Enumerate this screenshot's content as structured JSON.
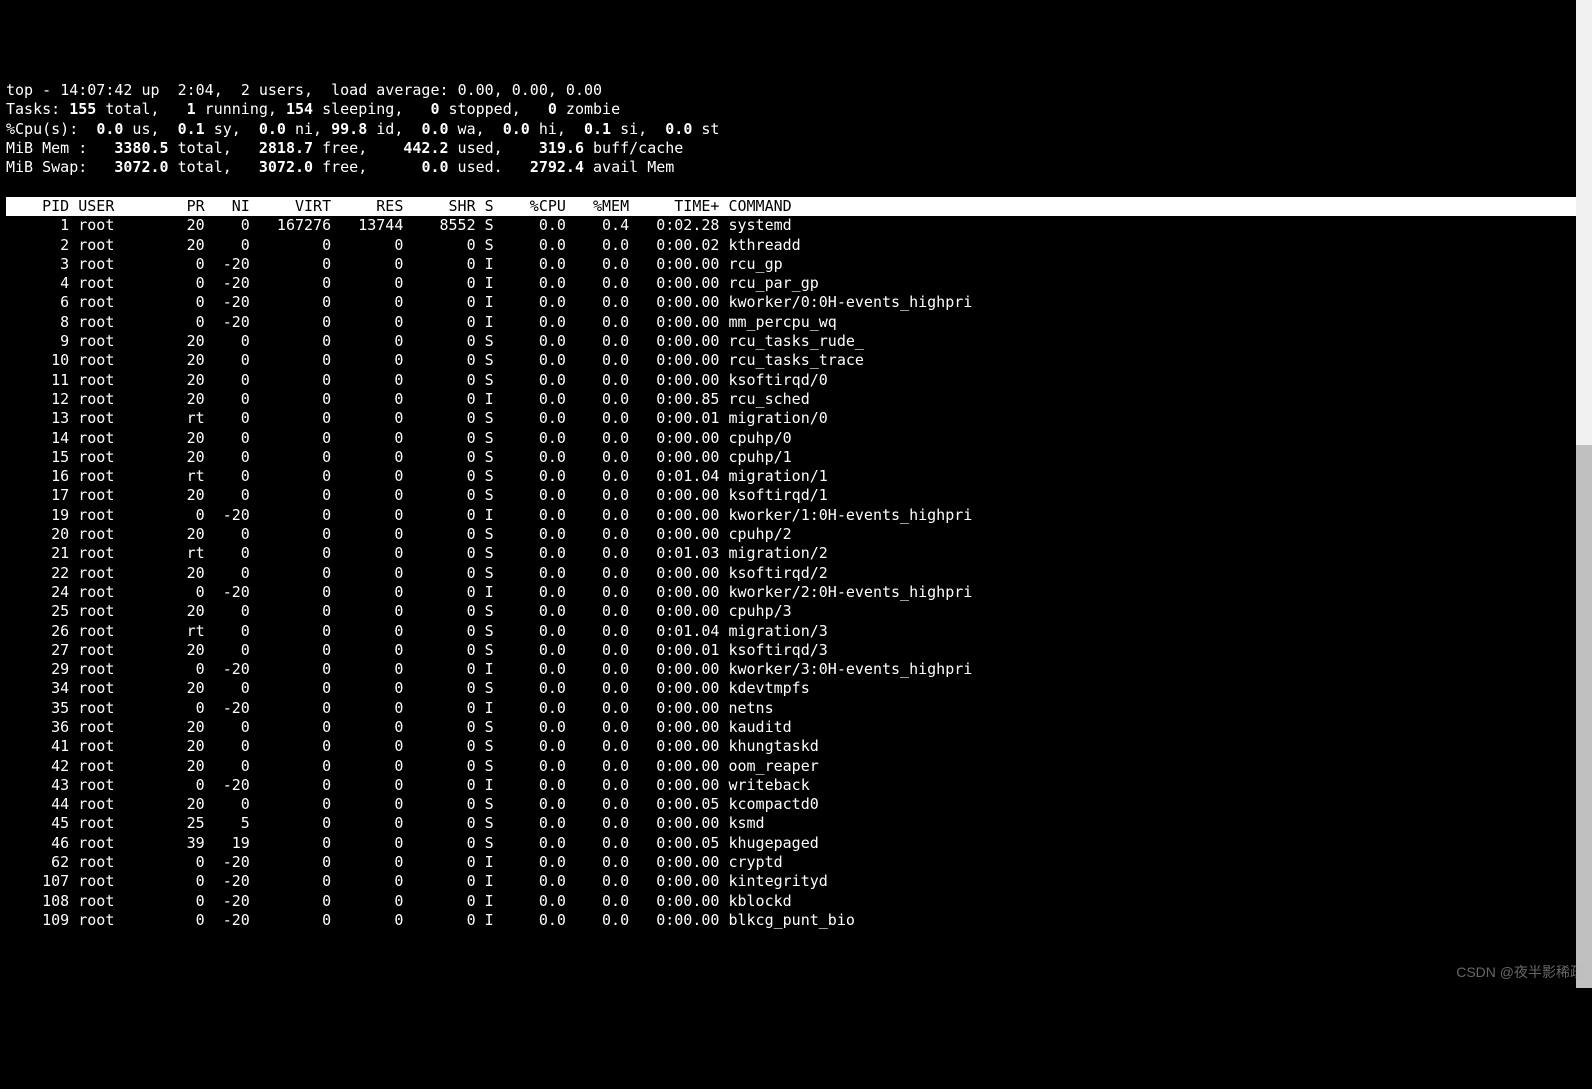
{
  "scrollbar": {
    "thumb_top_pct": 45,
    "thumb_height_pct": 55
  },
  "watermark": "CSDN @夜半影稀疏",
  "summary": {
    "line1": {
      "prefix": "top - ",
      "time": "14:07:42",
      "up_word": " up ",
      "uptime": " 2:04",
      "sep0": ",  ",
      "users": "2",
      "users_word": " users,  ",
      "la_word": "load average: ",
      "la": "0.00, 0.00, 0.00"
    },
    "line2": {
      "tasks_word": "Tasks: ",
      "total": "155",
      "total_word": " total,   ",
      "running": "1",
      "running_word": " running, ",
      "sleeping": "154",
      "sleeping_word": " sleeping,   ",
      "stopped": "0",
      "stopped_word": " stopped,   ",
      "zombie": "0",
      "zombie_word": " zombie"
    },
    "line3": {
      "cpu_word": "%Cpu(s):  ",
      "us": "0.0",
      "us_word": " us,  ",
      "sy": "0.1",
      "sy_word": " sy,  ",
      "ni": "0.0",
      "ni_word": " ni, ",
      "id": "99.8",
      "id_word": " id,  ",
      "wa": "0.0",
      "wa_word": " wa,  ",
      "hi": "0.0",
      "hi_word": " hi,  ",
      "si": "0.1",
      "si_word": " si,  ",
      "st": "0.0",
      "st_word": " st"
    },
    "line4": {
      "mem_word": "MiB Mem :   ",
      "total": "3380.5",
      "total_word": " total,   ",
      "free": "2818.7",
      "free_word": " free,    ",
      "used": "442.2",
      "used_word": " used,    ",
      "buff": "319.6",
      "buff_word": " buff/cache"
    },
    "line5": {
      "swap_word": "MiB Swap:   ",
      "total": "3072.0",
      "total_word": " total,   ",
      "free": "3072.0",
      "free_word": " free,      ",
      "used": "0.0",
      "used_word": " used.   ",
      "avail": "2792.4",
      "avail_word": " avail Mem"
    }
  },
  "columns": [
    "PID",
    "USER",
    "PR",
    "NI",
    "VIRT",
    "RES",
    "SHR",
    "S",
    "%CPU",
    "%MEM",
    "TIME+",
    "COMMAND"
  ],
  "widths": [
    7,
    9,
    4,
    4,
    8,
    7,
    7,
    2,
    6,
    6,
    9,
    30
  ],
  "aligns": [
    "r",
    "l",
    "r",
    "r",
    "r",
    "r",
    "r",
    "l",
    "r",
    "r",
    "r",
    "l"
  ],
  "processes": [
    [
      "1",
      "root",
      "20",
      "0",
      "167276",
      "13744",
      "8552",
      "S",
      "0.0",
      "0.4",
      "0:02.28",
      "systemd"
    ],
    [
      "2",
      "root",
      "20",
      "0",
      "0",
      "0",
      "0",
      "S",
      "0.0",
      "0.0",
      "0:00.02",
      "kthreadd"
    ],
    [
      "3",
      "root",
      "0",
      "-20",
      "0",
      "0",
      "0",
      "I",
      "0.0",
      "0.0",
      "0:00.00",
      "rcu_gp"
    ],
    [
      "4",
      "root",
      "0",
      "-20",
      "0",
      "0",
      "0",
      "I",
      "0.0",
      "0.0",
      "0:00.00",
      "rcu_par_gp"
    ],
    [
      "6",
      "root",
      "0",
      "-20",
      "0",
      "0",
      "0",
      "I",
      "0.0",
      "0.0",
      "0:00.00",
      "kworker/0:0H-events_highpri"
    ],
    [
      "8",
      "root",
      "0",
      "-20",
      "0",
      "0",
      "0",
      "I",
      "0.0",
      "0.0",
      "0:00.00",
      "mm_percpu_wq"
    ],
    [
      "9",
      "root",
      "20",
      "0",
      "0",
      "0",
      "0",
      "S",
      "0.0",
      "0.0",
      "0:00.00",
      "rcu_tasks_rude_"
    ],
    [
      "10",
      "root",
      "20",
      "0",
      "0",
      "0",
      "0",
      "S",
      "0.0",
      "0.0",
      "0:00.00",
      "rcu_tasks_trace"
    ],
    [
      "11",
      "root",
      "20",
      "0",
      "0",
      "0",
      "0",
      "S",
      "0.0",
      "0.0",
      "0:00.00",
      "ksoftirqd/0"
    ],
    [
      "12",
      "root",
      "20",
      "0",
      "0",
      "0",
      "0",
      "I",
      "0.0",
      "0.0",
      "0:00.85",
      "rcu_sched"
    ],
    [
      "13",
      "root",
      "rt",
      "0",
      "0",
      "0",
      "0",
      "S",
      "0.0",
      "0.0",
      "0:00.01",
      "migration/0"
    ],
    [
      "14",
      "root",
      "20",
      "0",
      "0",
      "0",
      "0",
      "S",
      "0.0",
      "0.0",
      "0:00.00",
      "cpuhp/0"
    ],
    [
      "15",
      "root",
      "20",
      "0",
      "0",
      "0",
      "0",
      "S",
      "0.0",
      "0.0",
      "0:00.00",
      "cpuhp/1"
    ],
    [
      "16",
      "root",
      "rt",
      "0",
      "0",
      "0",
      "0",
      "S",
      "0.0",
      "0.0",
      "0:01.04",
      "migration/1"
    ],
    [
      "17",
      "root",
      "20",
      "0",
      "0",
      "0",
      "0",
      "S",
      "0.0",
      "0.0",
      "0:00.00",
      "ksoftirqd/1"
    ],
    [
      "19",
      "root",
      "0",
      "-20",
      "0",
      "0",
      "0",
      "I",
      "0.0",
      "0.0",
      "0:00.00",
      "kworker/1:0H-events_highpri"
    ],
    [
      "20",
      "root",
      "20",
      "0",
      "0",
      "0",
      "0",
      "S",
      "0.0",
      "0.0",
      "0:00.00",
      "cpuhp/2"
    ],
    [
      "21",
      "root",
      "rt",
      "0",
      "0",
      "0",
      "0",
      "S",
      "0.0",
      "0.0",
      "0:01.03",
      "migration/2"
    ],
    [
      "22",
      "root",
      "20",
      "0",
      "0",
      "0",
      "0",
      "S",
      "0.0",
      "0.0",
      "0:00.00",
      "ksoftirqd/2"
    ],
    [
      "24",
      "root",
      "0",
      "-20",
      "0",
      "0",
      "0",
      "I",
      "0.0",
      "0.0",
      "0:00.00",
      "kworker/2:0H-events_highpri"
    ],
    [
      "25",
      "root",
      "20",
      "0",
      "0",
      "0",
      "0",
      "S",
      "0.0",
      "0.0",
      "0:00.00",
      "cpuhp/3"
    ],
    [
      "26",
      "root",
      "rt",
      "0",
      "0",
      "0",
      "0",
      "S",
      "0.0",
      "0.0",
      "0:01.04",
      "migration/3"
    ],
    [
      "27",
      "root",
      "20",
      "0",
      "0",
      "0",
      "0",
      "S",
      "0.0",
      "0.0",
      "0:00.01",
      "ksoftirqd/3"
    ],
    [
      "29",
      "root",
      "0",
      "-20",
      "0",
      "0",
      "0",
      "I",
      "0.0",
      "0.0",
      "0:00.00",
      "kworker/3:0H-events_highpri"
    ],
    [
      "34",
      "root",
      "20",
      "0",
      "0",
      "0",
      "0",
      "S",
      "0.0",
      "0.0",
      "0:00.00",
      "kdevtmpfs"
    ],
    [
      "35",
      "root",
      "0",
      "-20",
      "0",
      "0",
      "0",
      "I",
      "0.0",
      "0.0",
      "0:00.00",
      "netns"
    ],
    [
      "36",
      "root",
      "20",
      "0",
      "0",
      "0",
      "0",
      "S",
      "0.0",
      "0.0",
      "0:00.00",
      "kauditd"
    ],
    [
      "41",
      "root",
      "20",
      "0",
      "0",
      "0",
      "0",
      "S",
      "0.0",
      "0.0",
      "0:00.00",
      "khungtaskd"
    ],
    [
      "42",
      "root",
      "20",
      "0",
      "0",
      "0",
      "0",
      "S",
      "0.0",
      "0.0",
      "0:00.00",
      "oom_reaper"
    ],
    [
      "43",
      "root",
      "0",
      "-20",
      "0",
      "0",
      "0",
      "I",
      "0.0",
      "0.0",
      "0:00.00",
      "writeback"
    ],
    [
      "44",
      "root",
      "20",
      "0",
      "0",
      "0",
      "0",
      "S",
      "0.0",
      "0.0",
      "0:00.05",
      "kcompactd0"
    ],
    [
      "45",
      "root",
      "25",
      "5",
      "0",
      "0",
      "0",
      "S",
      "0.0",
      "0.0",
      "0:00.00",
      "ksmd"
    ],
    [
      "46",
      "root",
      "39",
      "19",
      "0",
      "0",
      "0",
      "S",
      "0.0",
      "0.0",
      "0:00.05",
      "khugepaged"
    ],
    [
      "62",
      "root",
      "0",
      "-20",
      "0",
      "0",
      "0",
      "I",
      "0.0",
      "0.0",
      "0:00.00",
      "cryptd"
    ],
    [
      "107",
      "root",
      "0",
      "-20",
      "0",
      "0",
      "0",
      "I",
      "0.0",
      "0.0",
      "0:00.00",
      "kintegrityd"
    ],
    [
      "108",
      "root",
      "0",
      "-20",
      "0",
      "0",
      "0",
      "I",
      "0.0",
      "0.0",
      "0:00.00",
      "kblockd"
    ],
    [
      "109",
      "root",
      "0",
      "-20",
      "0",
      "0",
      "0",
      "I",
      "0.0",
      "0.0",
      "0:00.00",
      "blkcg_punt_bio"
    ]
  ]
}
